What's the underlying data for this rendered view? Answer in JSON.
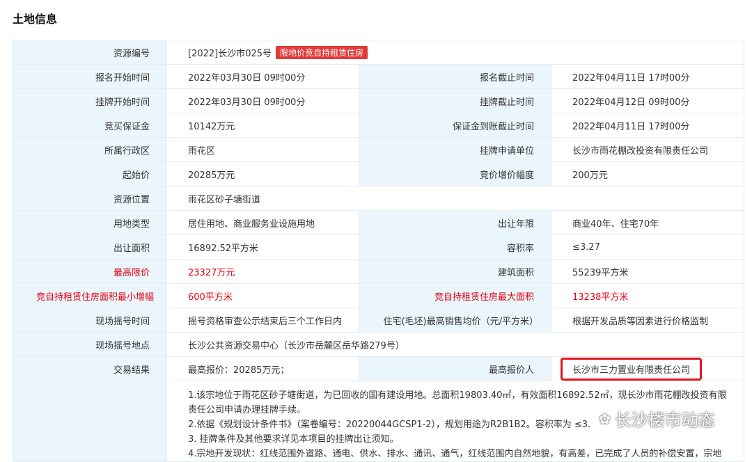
{
  "page_title": "土地信息",
  "badge": "限地价竞自持租赁住房",
  "rows": {
    "r1": {
      "l1": "资源编号",
      "v1": "[2022]长沙市025号"
    },
    "r2": {
      "l1": "报名开始时间",
      "v1": "2022年03月30日 09时00分",
      "l2": "报名截止时间",
      "v2": "2022年04月11日 17时00分"
    },
    "r3": {
      "l1": "挂牌开始时间",
      "v1": "2022年03月30日 09时00分",
      "l2": "挂牌截止时间",
      "v2": "2022年04月12日 09时00分"
    },
    "r4": {
      "l1": "竞买保证金",
      "v1": "10142万元",
      "l2": "保证金到账截止时间",
      "v2": "2022年04月11日 17时00分"
    },
    "r5": {
      "l1": "所属行政区",
      "v1": "雨花区",
      "l2": "挂牌申请单位",
      "v2": "长沙市雨花棚改投资有限责任公司"
    },
    "r6": {
      "l1": "起始价",
      "v1": "20285万元",
      "l2": "竞价增价幅度",
      "v2": "200万元"
    },
    "r7": {
      "l1": "资源位置",
      "v1": "雨花区砂子塘街道"
    },
    "r8": {
      "l1": "用地类型",
      "v1": "居住用地、商业服务业设施用地",
      "l2": "出让年限",
      "v2": "商业40年、住宅70年"
    },
    "r9": {
      "l1": "出让面积",
      "v1": "16892.52平方米",
      "l2": "容积率",
      "v2": "≤3.27"
    },
    "r10": {
      "l1": "最高限价",
      "v1": "23327万元",
      "l2": "建筑面积",
      "v2": "55239平方米"
    },
    "r11": {
      "l1": "竞自持租赁住房面积最小增幅",
      "v1": "600平方米",
      "l2": "竞自持租赁住房最大面积",
      "v2": "13238平方米"
    },
    "r12": {
      "l1": "现场摇号时间",
      "v1": "摇号资格审查公示结束后三个工作日内",
      "l2": "住宅(毛坯)最高销售均价（元/平方米）",
      "v2": "根据开发品质等因素进行价格监制"
    },
    "r13": {
      "l1": "现场摇号地点",
      "v1": "长沙公共资源交易中心（长沙市岳麓区岳华路279号）"
    },
    "r14": {
      "l1": "交易结果",
      "v1": "最高报价：20285万元；",
      "l2": "最高报价人",
      "v2": "长沙市三力置业有限责任公司"
    }
  },
  "notes": [
    "1.该宗地位于雨花区砂子塘街道，为已回收的国有建设用地。总面积19803.40㎡，有效面积16892.52㎡，现长沙市雨花棚改投资有限",
    "责任公司申请办理挂牌手续。",
    "2.依据《规划设计条件书》（案卷编号：20220044GCSP1-2），规划用途为R2B1B2。容积率为 ≤3.",
    "3. 挂牌条件及其他要求详见本项目的挂牌出让须知。",
    "4.宗地开发现状：红线范围外道路、通电、供水、排水、通讯、通气，红线范围内自然地貌，有高差，已完成了人员的补偿安置，宗地"
  ],
  "watermark": "长沙楼市动态",
  "colors": {
    "label_bg": "#eaf5fc",
    "border": "#e3ecf3",
    "red": "#e60012",
    "badge": "#e03b3b"
  }
}
